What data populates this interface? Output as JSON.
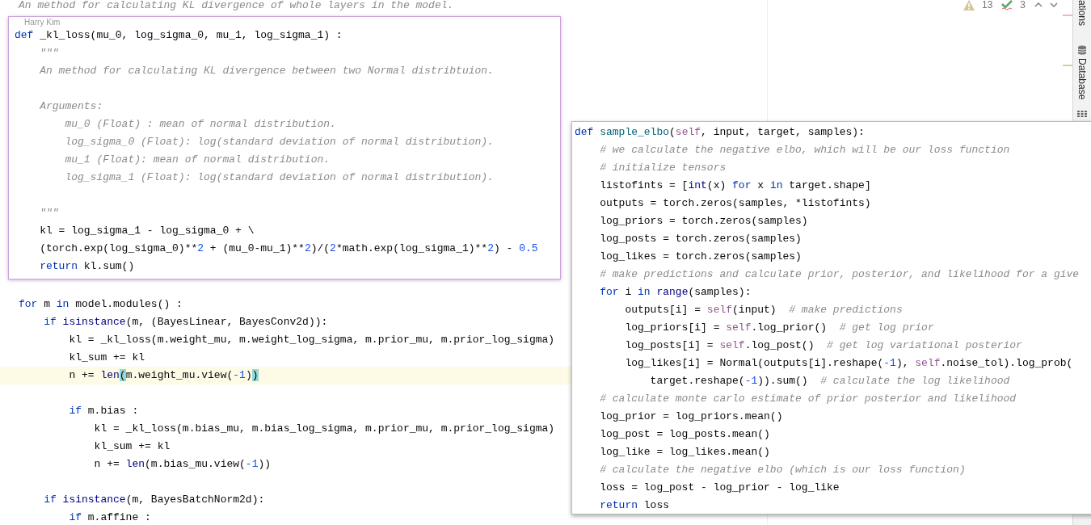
{
  "editor": {
    "lines": [
      {
        "current": false,
        "tokens": [
          {
            "text": "An method for calculating KL divergence of whole layers in the model.",
            "kind": "doc"
          }
        ]
      },
      {
        "current": false,
        "tokens": [
          {
            "text": "for",
            "kind": "kw"
          },
          {
            "text": " m "
          },
          {
            "text": "in",
            "kind": "kw"
          },
          {
            "text": " model.modules() :"
          }
        ]
      },
      {
        "current": false,
        "tokens": [
          {
            "text": "    if",
            "kind": "kw"
          },
          {
            "text": " isinstance",
            "kind": "builtin"
          },
          {
            "text": "(m, (BayesLinear, BayesConv2d)):"
          }
        ]
      },
      {
        "current": false,
        "tokens": [
          {
            "text": "        kl = _kl_loss(m.weight_mu, m.weight_log_sigma, m.prior_mu, m.prior_log_sigma)"
          }
        ]
      },
      {
        "current": false,
        "tokens": [
          {
            "text": "        kl_sum += kl"
          }
        ]
      },
      {
        "current": true,
        "tokens": [
          {
            "text": "        n += "
          },
          {
            "text": "len",
            "kind": "builtin"
          },
          {
            "text": "(",
            "kind": "match"
          },
          {
            "text": "m.weight_mu.view("
          },
          {
            "text": "-1",
            "kind": "num"
          },
          {
            "text": ")"
          },
          {
            "text": ")",
            "kind": "match"
          }
        ]
      },
      {
        "kind": "blank",
        "current": false
      },
      {
        "current": false,
        "tokens": [
          {
            "text": "        if",
            "kind": "kw"
          },
          {
            "text": " m.bias :"
          }
        ]
      },
      {
        "current": false,
        "tokens": [
          {
            "text": "            kl = _kl_loss(m.bias_mu, m.bias_log_sigma, m.prior_mu, m.prior_log_sigma)"
          }
        ]
      },
      {
        "current": false,
        "tokens": [
          {
            "text": "            kl_sum += kl"
          }
        ]
      },
      {
        "current": false,
        "tokens": [
          {
            "text": "            n += "
          },
          {
            "text": "len",
            "kind": "builtin"
          },
          {
            "text": "(m.bias_mu.view("
          },
          {
            "text": "-1",
            "kind": "num"
          },
          {
            "text": "))"
          }
        ]
      },
      {
        "kind": "blank",
        "current": false
      },
      {
        "current": false,
        "tokens": [
          {
            "text": "    if",
            "kind": "kw"
          },
          {
            "text": " isinstance",
            "kind": "builtin"
          },
          {
            "text": "(m, BayesBatchNorm2d):"
          }
        ]
      },
      {
        "current": false,
        "tokens": [
          {
            "text": "        if",
            "kind": "kw"
          },
          {
            "text": " m.affine :"
          }
        ]
      }
    ]
  },
  "popups": [
    {
      "author": "Harry Kim",
      "lines": [
        {
          "tokens": [
            {
              "text": "def",
              "kind": "kw"
            },
            {
              "text": " _kl_loss(mu_0, log_sigma_0, mu_1, log_sigma_1) :"
            }
          ]
        },
        {
          "tokens": [
            {
              "text": "    \"\"\"",
              "kind": "doc"
            }
          ]
        },
        {
          "tokens": [
            {
              "text": "    An method for calculating KL divergence between two Normal distribtuion.",
              "kind": "doc"
            }
          ]
        },
        {
          "kind": "blank"
        },
        {
          "tokens": [
            {
              "text": "    Arguments:",
              "kind": "doc"
            }
          ]
        },
        {
          "tokens": [
            {
              "text": "        mu_0 (Float) : mean of normal distribution.",
              "kind": "doc"
            }
          ]
        },
        {
          "tokens": [
            {
              "text": "        log_sigma_0 (Float): log(standard deviation of normal distribution).",
              "kind": "doc"
            }
          ]
        },
        {
          "tokens": [
            {
              "text": "        mu_1 (Float): mean of normal distribution.",
              "kind": "doc"
            }
          ]
        },
        {
          "tokens": [
            {
              "text": "        log_sigma_1 (Float): log(standard deviation of normal distribution).",
              "kind": "doc"
            }
          ]
        },
        {
          "kind": "blank"
        },
        {
          "tokens": [
            {
              "text": "    \"\"\"",
              "kind": "doc"
            }
          ]
        },
        {
          "tokens": [
            {
              "text": "    kl = log_sigma_1 - log_sigma_0 + \\"
            }
          ]
        },
        {
          "tokens": [
            {
              "text": "    (torch.exp(log_sigma_0)**"
            },
            {
              "text": "2",
              "kind": "num"
            },
            {
              "text": " + (mu_0-mu_1)**"
            },
            {
              "text": "2",
              "kind": "num"
            },
            {
              "text": ")/("
            },
            {
              "text": "2",
              "kind": "num"
            },
            {
              "text": "*math.exp(log_sigma_1)**"
            },
            {
              "text": "2",
              "kind": "num"
            },
            {
              "text": ") - "
            },
            {
              "text": "0.5",
              "kind": "num"
            }
          ]
        },
        {
          "tokens": [
            {
              "text": "    return",
              "kind": "kw"
            },
            {
              "text": " kl.sum()"
            }
          ]
        }
      ]
    },
    {
      "lines": [
        {
          "tokens": [
            {
              "text": "def",
              "kind": "kw"
            },
            {
              "text": " sample_elbo",
              "kind": "fn"
            },
            {
              "text": "("
            },
            {
              "text": "self",
              "kind": "self"
            },
            {
              "text": ", input, target, samples):"
            }
          ]
        },
        {
          "tokens": [
            {
              "text": "    # we calculate the negative elbo, which will be our loss function",
              "kind": "comment"
            }
          ]
        },
        {
          "tokens": [
            {
              "text": "    # initialize tensors",
              "kind": "comment"
            }
          ]
        },
        {
          "tokens": [
            {
              "text": "    listofints = ["
            },
            {
              "text": "int",
              "kind": "builtin"
            },
            {
              "text": "(x) "
            },
            {
              "text": "for",
              "kind": "kw"
            },
            {
              "text": " x "
            },
            {
              "text": "in",
              "kind": "kw"
            },
            {
              "text": " target.shape]"
            }
          ]
        },
        {
          "tokens": [
            {
              "text": "    outputs = torch.zeros(samples, *listofints)"
            }
          ]
        },
        {
          "tokens": [
            {
              "text": "    log_priors = torch.zeros(samples)"
            }
          ]
        },
        {
          "tokens": [
            {
              "text": "    log_posts = torch.zeros(samples)"
            }
          ]
        },
        {
          "tokens": [
            {
              "text": "    log_likes = torch.zeros(samples)"
            }
          ]
        },
        {
          "tokens": [
            {
              "text": "    # make predictions and calculate prior, posterior, and likelihood for a give",
              "kind": "comment"
            }
          ]
        },
        {
          "tokens": [
            {
              "text": "    for",
              "kind": "kw"
            },
            {
              "text": " i "
            },
            {
              "text": "in",
              "kind": "kw"
            },
            {
              "text": " range",
              "kind": "builtin"
            },
            {
              "text": "(samples):"
            }
          ]
        },
        {
          "tokens": [
            {
              "text": "        outputs[i] = "
            },
            {
              "text": "self",
              "kind": "self"
            },
            {
              "text": "(input)  "
            },
            {
              "text": "# make predictions",
              "kind": "comment"
            }
          ]
        },
        {
          "tokens": [
            {
              "text": "        log_priors[i] = "
            },
            {
              "text": "self",
              "kind": "self"
            },
            {
              "text": ".log_prior()  "
            },
            {
              "text": "# get log prior",
              "kind": "comment"
            }
          ]
        },
        {
          "tokens": [
            {
              "text": "        log_posts[i] = "
            },
            {
              "text": "self",
              "kind": "self"
            },
            {
              "text": ".log_post()  "
            },
            {
              "text": "# get log variational posterior",
              "kind": "comment"
            }
          ]
        },
        {
          "tokens": [
            {
              "text": "        log_likes[i] = Normal(outputs[i].reshape("
            },
            {
              "text": "-1",
              "kind": "num"
            },
            {
              "text": "), "
            },
            {
              "text": "self",
              "kind": "self"
            },
            {
              "text": ".noise_tol).log_prob("
            }
          ]
        },
        {
          "tokens": [
            {
              "text": "            target.reshape("
            },
            {
              "text": "-1",
              "kind": "num"
            },
            {
              "text": ")).sum()  "
            },
            {
              "text": "# calculate the log likelihood",
              "kind": "comment"
            }
          ]
        },
        {
          "tokens": [
            {
              "text": "    # calculate monte carlo estimate of prior posterior and likelihood",
              "kind": "comment"
            }
          ]
        },
        {
          "tokens": [
            {
              "text": "    log_prior = log_priors.mean()"
            }
          ]
        },
        {
          "tokens": [
            {
              "text": "    log_post = log_posts.mean()"
            }
          ]
        },
        {
          "tokens": [
            {
              "text": "    log_like = log_likes.mean()"
            }
          ]
        },
        {
          "tokens": [
            {
              "text": "    # calculate the negative elbo (which is our loss function)",
              "kind": "comment"
            }
          ]
        },
        {
          "tokens": [
            {
              "text": "    loss = log_post - log_prior - log_like"
            }
          ]
        },
        {
          "tokens": [
            {
              "text": "    return",
              "kind": "kw"
            },
            {
              "text": " loss"
            }
          ]
        }
      ]
    }
  ],
  "inspections": {
    "warnings": "13",
    "weak_warnings": "3"
  },
  "tool_strip": {
    "tabs": [
      "ations",
      "Database"
    ]
  }
}
